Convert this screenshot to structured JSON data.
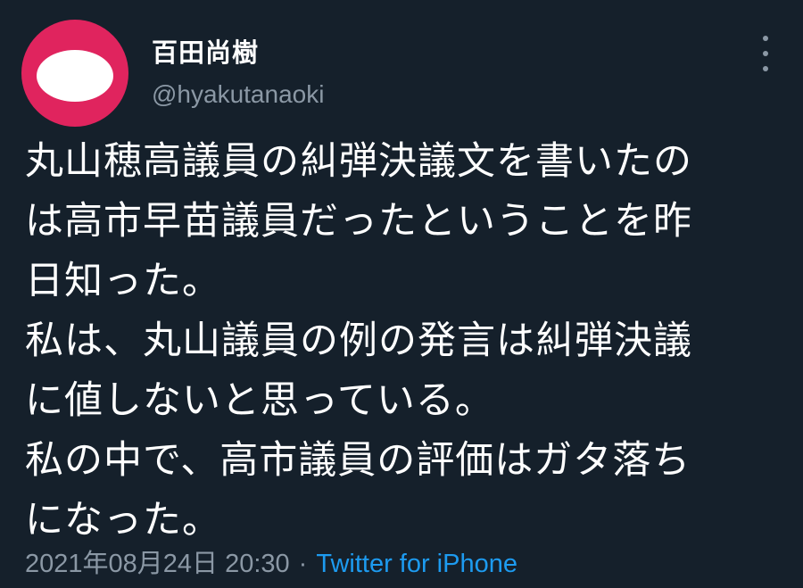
{
  "author": {
    "display_name": "百田尚樹",
    "handle": "@hyakutanaoki",
    "avatar_color": "#e0245e"
  },
  "tweet": {
    "lines": [
      "丸山穂高議員の糾弾決議文を書いたの",
      "は高市早苗議員だったということを昨",
      "日知った。",
      "私は、丸山議員の例の発言は糾弾決議",
      "に値しないと思っている。",
      "私の中で、高市議員の評価はガタ落ち",
      "になった。"
    ],
    "timestamp": "2021年08月24日 20:30",
    "separator": "·",
    "source": "Twitter for iPhone"
  },
  "colors": {
    "background": "#15202b",
    "text": "#ffffff",
    "muted": "#8b98a5",
    "link": "#1d9bf0"
  },
  "icons": {
    "more": "more-vertical-icon"
  }
}
